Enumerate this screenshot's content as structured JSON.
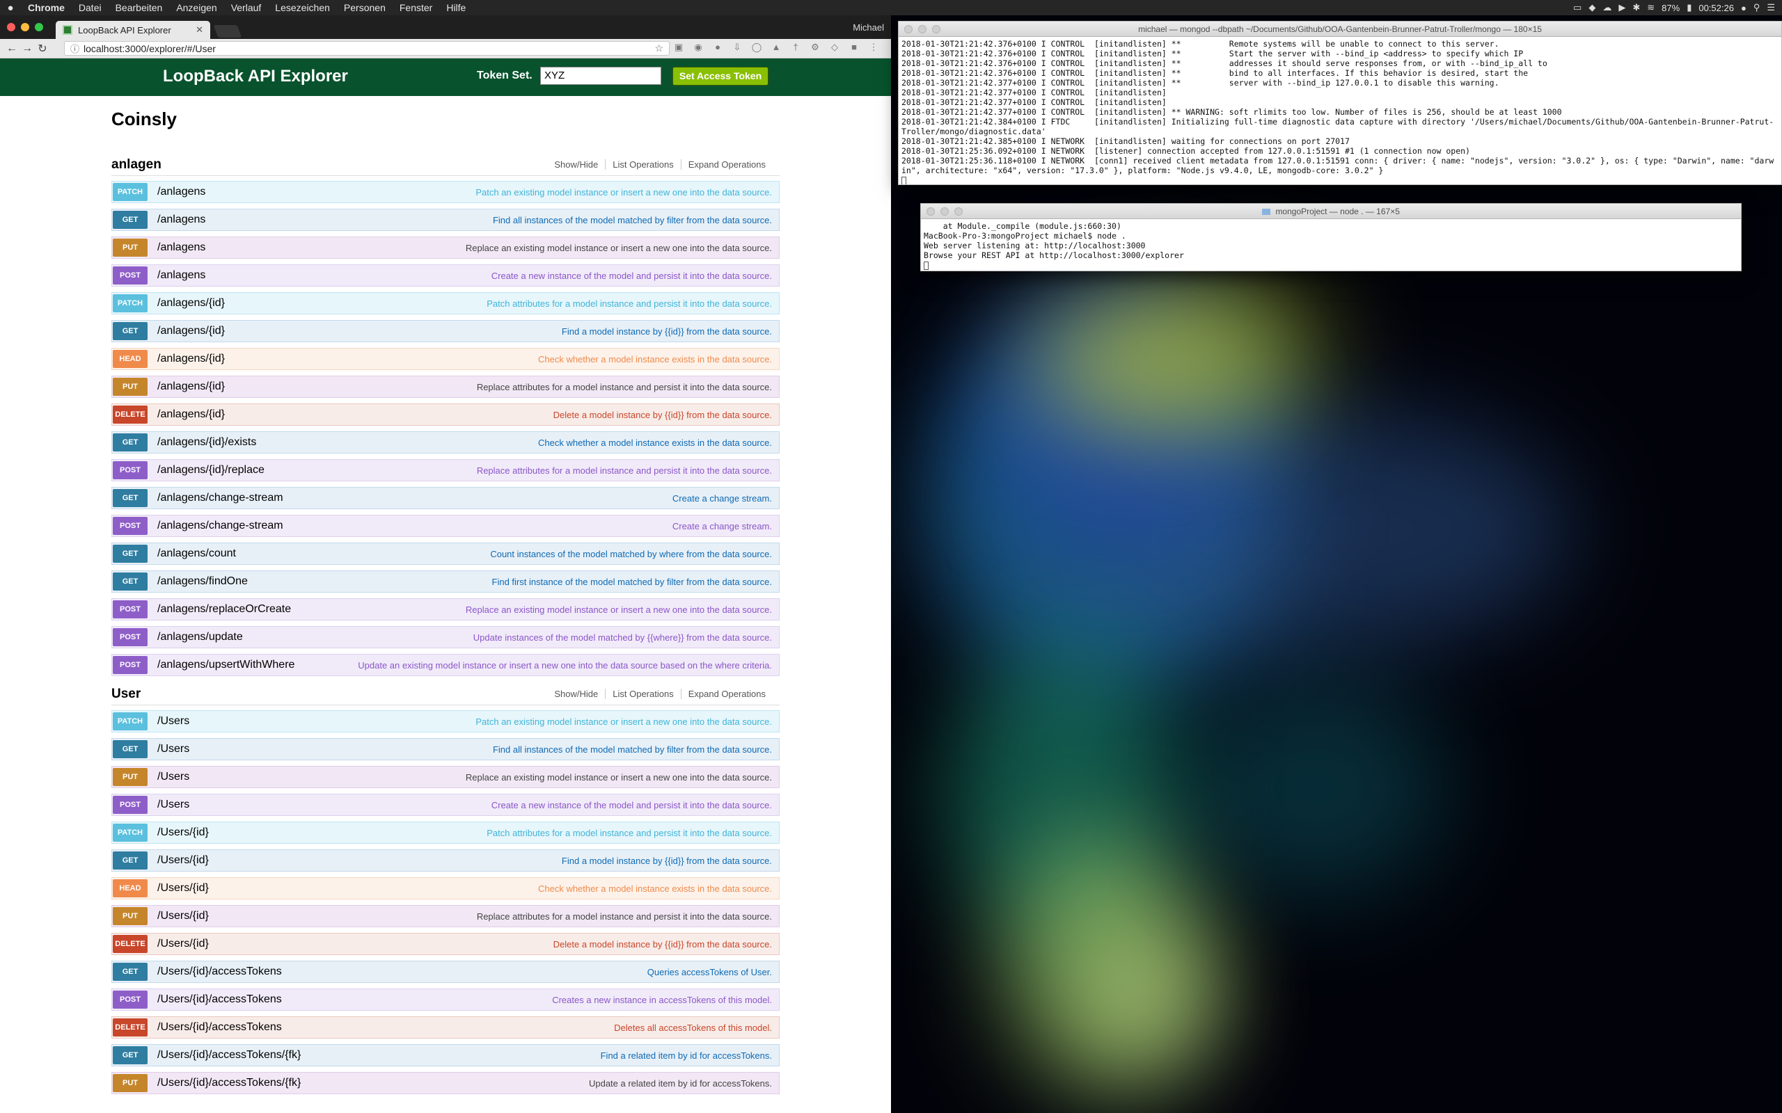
{
  "menubar": {
    "apple": "",
    "items": [
      "Chrome",
      "Datei",
      "Bearbeiten",
      "Anzeigen",
      "Verlauf",
      "Lesezeichen",
      "Personen",
      "Fenster",
      "Hilfe"
    ],
    "battery": "87%",
    "clock": "00:52:26"
  },
  "browser": {
    "tab_title": "LoopBack API Explorer",
    "profile": "Michael",
    "url": "localhost:3000/explorer/#/User"
  },
  "explorer": {
    "header_title": "LoopBack API Explorer",
    "token_label": "Token Set.",
    "token_value": "XYZ",
    "set_token_button": "Set Access Token",
    "app_title": "Coinsly",
    "resource_ops": {
      "show_hide": "Show/Hide",
      "list": "List Operations",
      "expand": "Expand Operations"
    },
    "resources": [
      {
        "name": "anlagen",
        "operations": [
          {
            "method": "PATCH",
            "path": "/anlagens",
            "summary": "Patch an existing model instance or insert a new one into the data source."
          },
          {
            "method": "GET",
            "path": "/anlagens",
            "summary": "Find all instances of the model matched by filter from the data source."
          },
          {
            "method": "PUT",
            "path": "/anlagens",
            "summary": "Replace an existing model instance or insert a new one into the data source."
          },
          {
            "method": "POST",
            "path": "/anlagens",
            "summary": "Create a new instance of the model and persist it into the data source."
          },
          {
            "method": "PATCH",
            "path": "/anlagens/{id}",
            "summary": "Patch attributes for a model instance and persist it into the data source."
          },
          {
            "method": "GET",
            "path": "/anlagens/{id}",
            "summary": "Find a model instance by {{id}} from the data source."
          },
          {
            "method": "HEAD",
            "path": "/anlagens/{id}",
            "summary": "Check whether a model instance exists in the data source."
          },
          {
            "method": "PUT",
            "path": "/anlagens/{id}",
            "summary": "Replace attributes for a model instance and persist it into the data source."
          },
          {
            "method": "DELETE",
            "path": "/anlagens/{id}",
            "summary": "Delete a model instance by {{id}} from the data source."
          },
          {
            "method": "GET",
            "path": "/anlagens/{id}/exists",
            "summary": "Check whether a model instance exists in the data source."
          },
          {
            "method": "POST",
            "path": "/anlagens/{id}/replace",
            "summary": "Replace attributes for a model instance and persist it into the data source."
          },
          {
            "method": "GET",
            "path": "/anlagens/change-stream",
            "summary": "Create a change stream."
          },
          {
            "method": "POST",
            "path": "/anlagens/change-stream",
            "summary": "Create a change stream."
          },
          {
            "method": "GET",
            "path": "/anlagens/count",
            "summary": "Count instances of the model matched by where from the data source."
          },
          {
            "method": "GET",
            "path": "/anlagens/findOne",
            "summary": "Find first instance of the model matched by filter from the data source."
          },
          {
            "method": "POST",
            "path": "/anlagens/replaceOrCreate",
            "summary": "Replace an existing model instance or insert a new one into the data source."
          },
          {
            "method": "POST",
            "path": "/anlagens/update",
            "summary": "Update instances of the model matched by {{where}} from the data source."
          },
          {
            "method": "POST",
            "path": "/anlagens/upsertWithWhere",
            "summary": "Update an existing model instance or insert a new one into the data source based on the where criteria."
          }
        ]
      },
      {
        "name": "User",
        "operations": [
          {
            "method": "PATCH",
            "path": "/Users",
            "summary": "Patch an existing model instance or insert a new one into the data source."
          },
          {
            "method": "GET",
            "path": "/Users",
            "summary": "Find all instances of the model matched by filter from the data source."
          },
          {
            "method": "PUT",
            "path": "/Users",
            "summary": "Replace an existing model instance or insert a new one into the data source."
          },
          {
            "method": "POST",
            "path": "/Users",
            "summary": "Create a new instance of the model and persist it into the data source."
          },
          {
            "method": "PATCH",
            "path": "/Users/{id}",
            "summary": "Patch attributes for a model instance and persist it into the data source."
          },
          {
            "method": "GET",
            "path": "/Users/{id}",
            "summary": "Find a model instance by {{id}} from the data source."
          },
          {
            "method": "HEAD",
            "path": "/Users/{id}",
            "summary": "Check whether a model instance exists in the data source."
          },
          {
            "method": "PUT",
            "path": "/Users/{id}",
            "summary": "Replace attributes for a model instance and persist it into the data source."
          },
          {
            "method": "DELETE",
            "path": "/Users/{id}",
            "summary": "Delete a model instance by {{id}} from the data source."
          },
          {
            "method": "GET",
            "path": "/Users/{id}/accessTokens",
            "summary": "Queries accessTokens of User."
          },
          {
            "method": "POST",
            "path": "/Users/{id}/accessTokens",
            "summary": "Creates a new instance in accessTokens of this model."
          },
          {
            "method": "DELETE",
            "path": "/Users/{id}/accessTokens",
            "summary": "Deletes all accessTokens of this model."
          },
          {
            "method": "GET",
            "path": "/Users/{id}/accessTokens/{fk}",
            "summary": "Find a related item by id for accessTokens."
          },
          {
            "method": "PUT",
            "path": "/Users/{id}/accessTokens/{fk}",
            "summary": "Update a related item by id for accessTokens."
          }
        ]
      }
    ]
  },
  "terminal_mongo": {
    "title": "michael — mongod --dbpath ~/Documents/Github/OOA-Gantenbein-Brunner-Patrut-Troller/mongo — 180×15",
    "lines": [
      "2018-01-30T21:21:42.376+0100 I CONTROL  [initandlisten] **          Remote systems will be unable to connect to this server.",
      "2018-01-30T21:21:42.376+0100 I CONTROL  [initandlisten] **          Start the server with --bind_ip <address> to specify which IP",
      "2018-01-30T21:21:42.376+0100 I CONTROL  [initandlisten] **          addresses it should serve responses from, or with --bind_ip_all to",
      "2018-01-30T21:21:42.376+0100 I CONTROL  [initandlisten] **          bind to all interfaces. If this behavior is desired, start the",
      "2018-01-30T21:21:42.377+0100 I CONTROL  [initandlisten] **          server with --bind_ip 127.0.0.1 to disable this warning.",
      "2018-01-30T21:21:42.377+0100 I CONTROL  [initandlisten]",
      "2018-01-30T21:21:42.377+0100 I CONTROL  [initandlisten]",
      "2018-01-30T21:21:42.377+0100 I CONTROL  [initandlisten] ** WARNING: soft rlimits too low. Number of files is 256, should be at least 1000",
      "2018-01-30T21:21:42.384+0100 I FTDC     [initandlisten] Initializing full-time diagnostic data capture with directory '/Users/michael/Documents/Github/OOA-Gantenbein-Brunner-Patrut-Troller/mongo/diagnostic.data'",
      "2018-01-30T21:21:42.385+0100 I NETWORK  [initandlisten] waiting for connections on port 27017",
      "2018-01-30T21:25:36.092+0100 I NETWORK  [listener] connection accepted from 127.0.0.1:51591 #1 (1 connection now open)",
      "2018-01-30T21:25:36.118+0100 I NETWORK  [conn1] received client metadata from 127.0.0.1:51591 conn: { driver: { name: \"nodejs\", version: \"3.0.2\" }, os: { type: \"Darwin\", name: \"darwin\", architecture: \"x64\", version: \"17.3.0\" }, platform: \"Node.js v9.4.0, LE, mongodb-core: 3.0.2\" }"
    ]
  },
  "terminal_node": {
    "title": "mongoProject — node . — 167×5",
    "lines": [
      "    at Module._compile (module.js:660:30)",
      "MacBook-Pro-3:mongoProject michael$ node .",
      "Web server listening at: http://localhost:3000",
      "Browse your REST API at http://localhost:3000/explorer"
    ]
  }
}
